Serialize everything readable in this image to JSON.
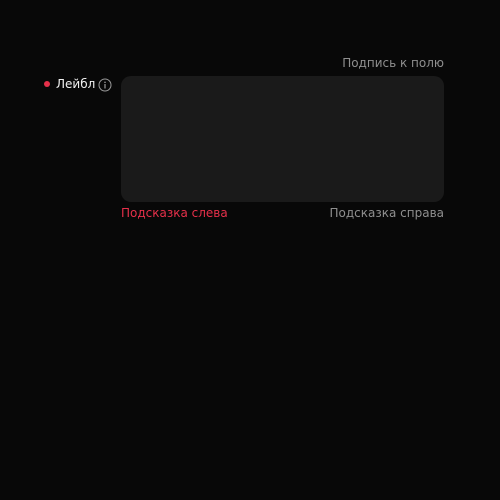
{
  "field": {
    "label": "Лейбл",
    "caption": "Подпись к полю",
    "value": "",
    "placeholder": "",
    "hint_left": "Подсказка слева",
    "hint_right": "Подсказка справа",
    "required": true,
    "info_icon": "info-circle-icon"
  },
  "colors": {
    "background": "#080808",
    "input_background": "#1a1a1a",
    "required_indicator": "#e6304a",
    "error_hint": "#e6304a",
    "secondary_text": "#8f8f8f",
    "primary_text": "#f2f2f2"
  }
}
